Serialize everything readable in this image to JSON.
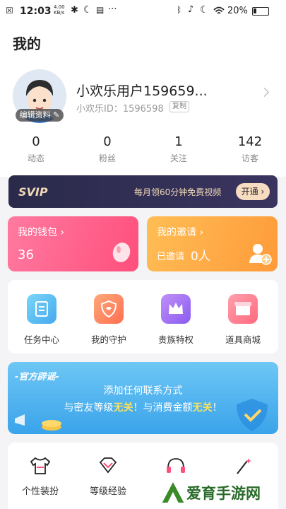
{
  "status_bar": {
    "time": "12:03",
    "net_speed": "4.00 KB/s",
    "battery": "20%"
  },
  "page_title": "我的",
  "profile": {
    "name": "小欢乐用户159659...",
    "id_label": "小欢乐ID：1596598",
    "copy_label": "复制",
    "edit_label": "编辑资料"
  },
  "stats": [
    {
      "value": "0",
      "label": "动态"
    },
    {
      "value": "0",
      "label": "粉丝"
    },
    {
      "value": "1",
      "label": "关注"
    },
    {
      "value": "142",
      "label": "访客"
    }
  ],
  "svip": {
    "logo": "SVIP",
    "text": "每月领60分钟免费视频",
    "button": "开通 ›"
  },
  "wallet": {
    "title": "我的钱包 ›",
    "value": "36"
  },
  "invite": {
    "title": "我的邀请 ›",
    "invited_label": "已邀请",
    "invited_count": "0人"
  },
  "features": [
    {
      "label": "任务中心",
      "icon": "task-icon",
      "color": "#5cc3f0"
    },
    {
      "label": "我的守护",
      "icon": "guard-icon",
      "color": "#ff8a5b"
    },
    {
      "label": "贵族特权",
      "icon": "crown-icon",
      "color": "#a377f3"
    },
    {
      "label": "道具商城",
      "icon": "shop-icon",
      "color": "#ff7a8c"
    }
  ],
  "banner": {
    "tag": "-官方辟谣-",
    "line1": "添加任何联系方式",
    "line2a": "与密友等级",
    "line2b": "无关",
    "line2c": "！与消费金额",
    "line2d": "无关",
    "line2e": "！"
  },
  "bottom_items": [
    {
      "label": "个性装扮",
      "icon": "shirt-icon"
    },
    {
      "label": "等级经验",
      "icon": "diamond-icon"
    },
    {
      "label": "",
      "icon": "headset-icon"
    },
    {
      "label": "",
      "icon": "magic-wand-icon"
    }
  ],
  "watermark": "爱育手游网"
}
